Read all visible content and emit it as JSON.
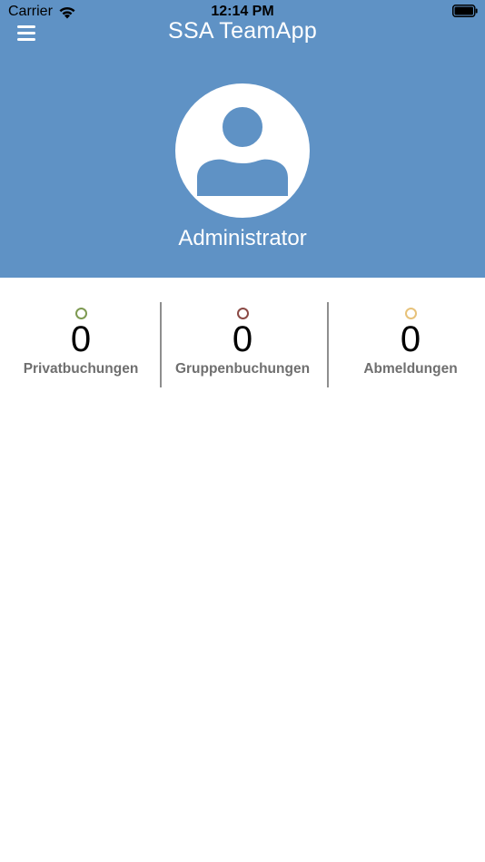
{
  "status_bar": {
    "carrier": "Carrier",
    "time": "12:14 PM",
    "wifi_icon": "wifi-icon",
    "battery_icon": "battery-full-icon"
  },
  "header": {
    "title": "SSA TeamApp",
    "menu_icon": "hamburger-menu-icon",
    "background_color": "#5f92c5"
  },
  "profile": {
    "avatar_icon": "user-silhouette-icon",
    "name": "Administrator"
  },
  "stats": [
    {
      "label": "Privatbuchungen",
      "value": "0",
      "dot_color": "#7e9a52"
    },
    {
      "label": "Gruppenbuchungen",
      "value": "0",
      "dot_color": "#8b4a45"
    },
    {
      "label": "Abmeldungen",
      "value": "0",
      "dot_color": "#e7c27a"
    }
  ]
}
